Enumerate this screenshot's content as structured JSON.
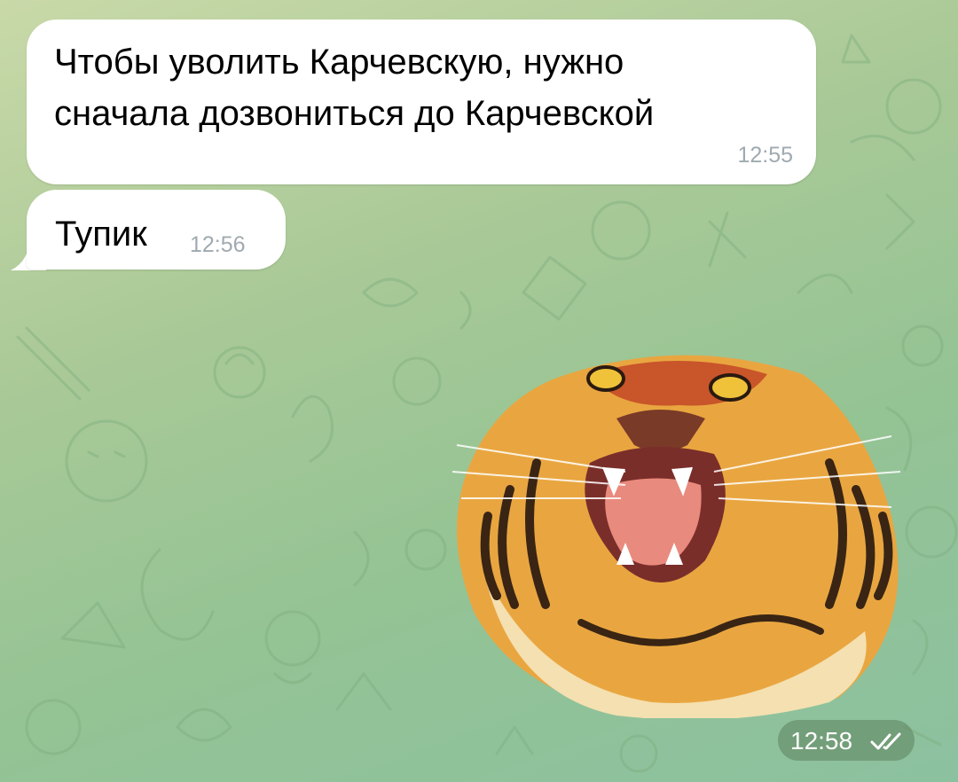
{
  "chat": {
    "messages": [
      {
        "text_line1": "Чтобы уволить Карчевскую, нужно",
        "text_line2": "сначала дозвониться до Карчевской",
        "time": "12:55"
      },
      {
        "text": "Тупик",
        "time": "12:56"
      }
    ],
    "sticker": {
      "icon": "tiger-head-sticker",
      "time": "12:58",
      "status_icon": "double-check-icon"
    }
  },
  "colors": {
    "bubble_incoming": "#ffffff",
    "timestamp_incoming": "#a0aab0",
    "background_top": "#c9d9a8",
    "background_bottom": "#8cc1a0"
  }
}
